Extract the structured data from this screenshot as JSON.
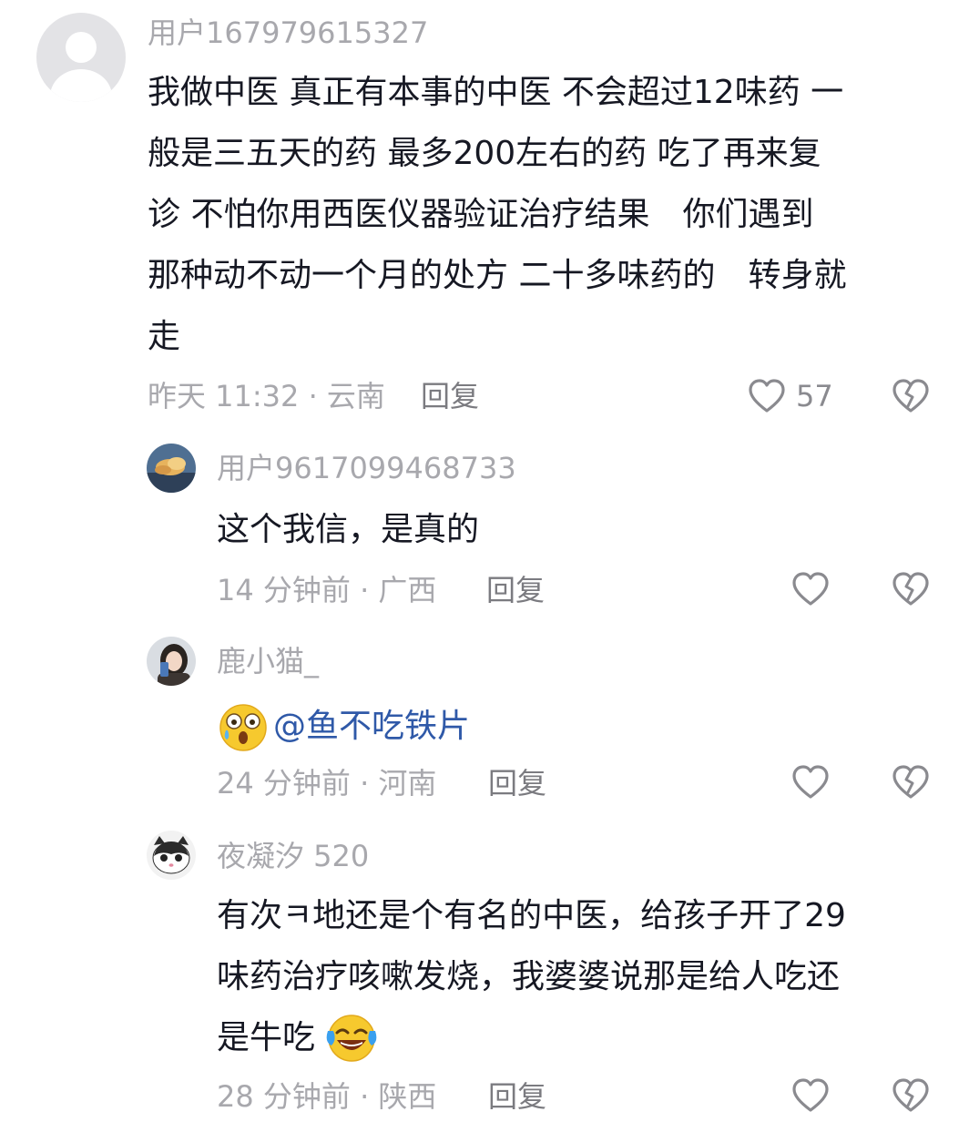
{
  "comments": [
    {
      "username": "用户167979615327",
      "lines": [
        "我做中医 真正有本事的中医 不会超过12味药 一",
        "般是三五天的药 最多200左右的药 吃了再来复",
        "诊 不怕你用西医仪器验证治疗结果　你们遇到",
        "那种动不动一个月的处方 二十多味药的　转身就",
        "走"
      ],
      "meta": "昨天 11:32 · 云南",
      "reply_label": "回复",
      "like_count": "57",
      "avatar_icon": "default-user-avatar"
    },
    {
      "username": "用户9617099468733",
      "lines": [
        "这个我信，是真的"
      ],
      "meta": "14 分钟前 · 广西",
      "reply_label": "回复",
      "avatar_icon": "sky-cloud-avatar"
    },
    {
      "username": "鹿小猫_",
      "emoji_icon": "shocked-face-emoji",
      "mention": "@鱼不吃铁片",
      "meta": "24 分钟前 · 河南",
      "reply_label": "回复",
      "avatar_icon": "girl-photo-avatar"
    },
    {
      "username": "夜凝汐 520",
      "lines": [
        "有次ㅋ地还是个有名的中医，给孩子开了29",
        "味药治疗咳嗽发烧，我婆婆说那是给人吃还",
        "是牛吃"
      ],
      "emoji_icon": "laughing-crying-emoji",
      "meta": "28 分钟前 · 陕西",
      "reply_label": "回复",
      "avatar_icon": "cat-avatar"
    }
  ],
  "colors": {
    "text": "#161823",
    "muted": "#a8a8ad",
    "reply": "#7b7b80",
    "mention": "#2f59a8",
    "icon": "#8a8a8f"
  }
}
